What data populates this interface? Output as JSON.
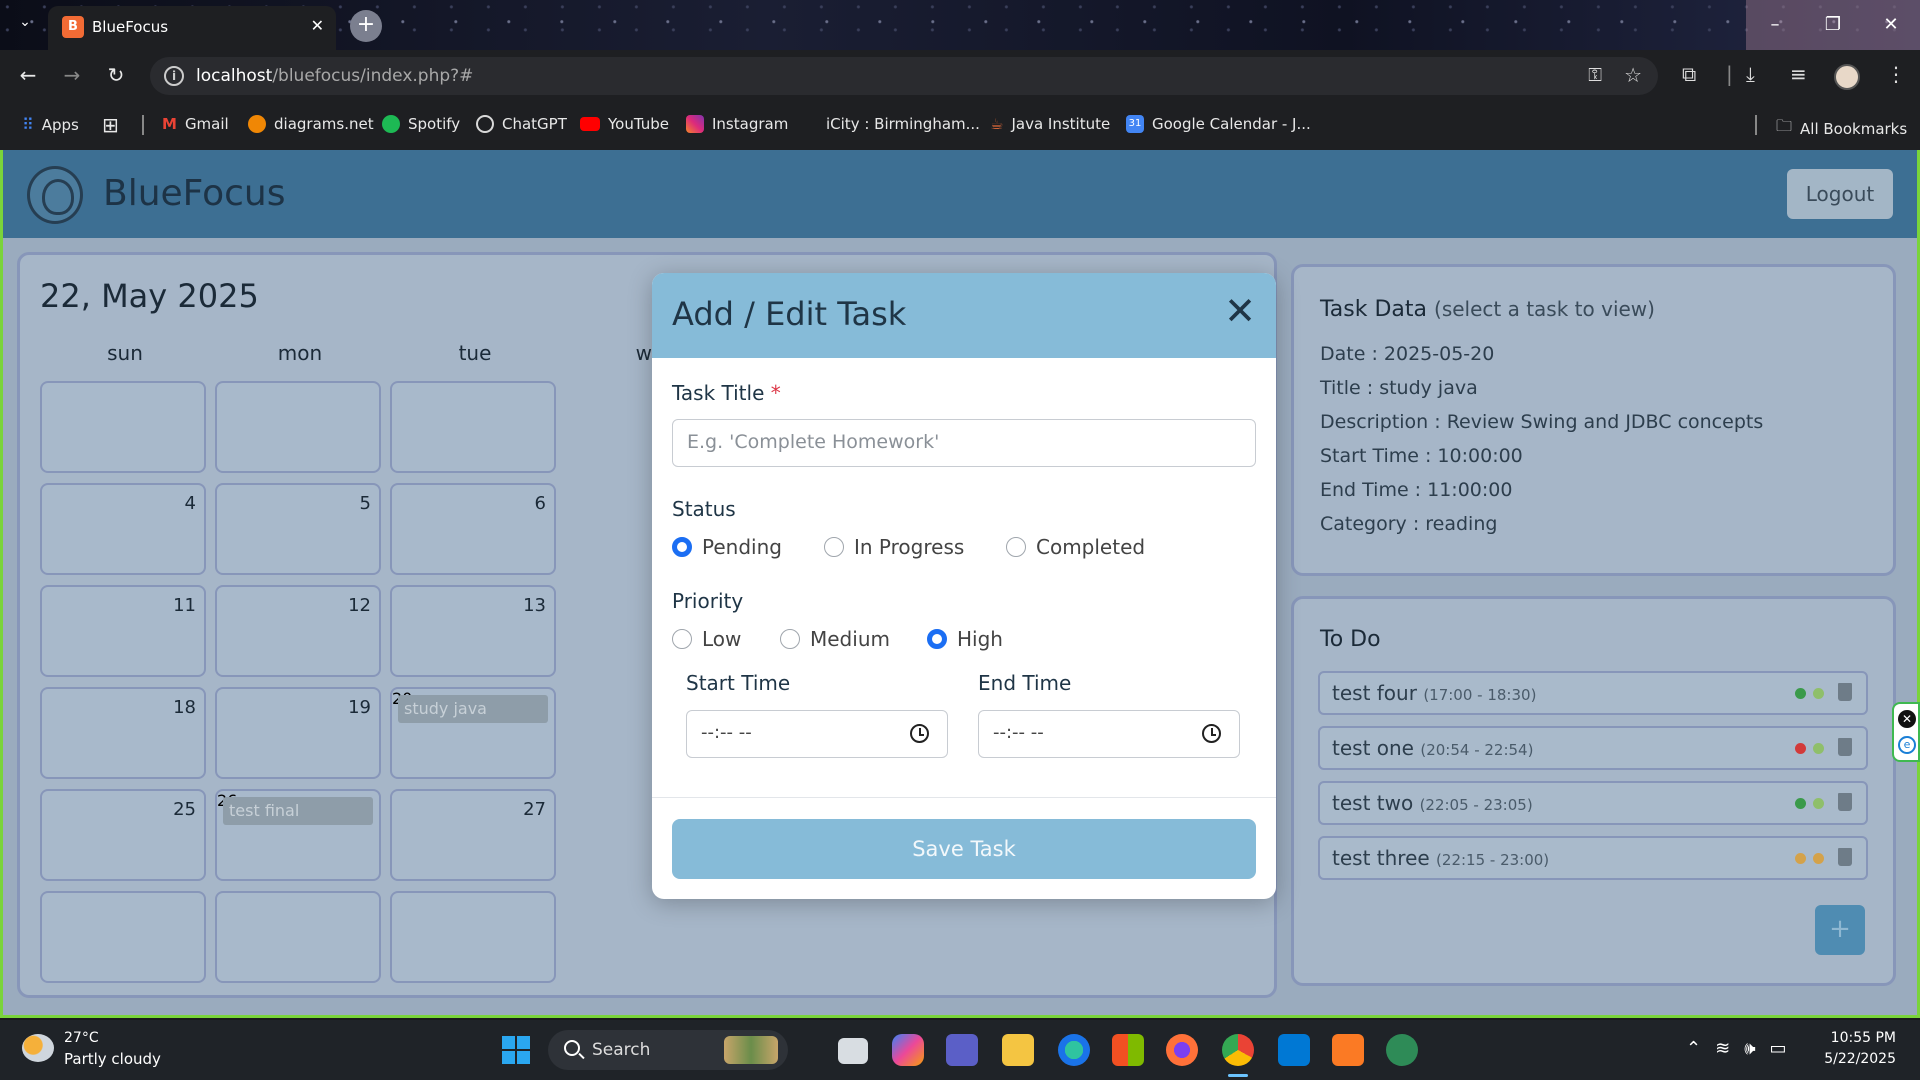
{
  "browser": {
    "tab_title": "BlueFocus",
    "url_host": "localhost",
    "url_path": "/bluefocus/index.php?#",
    "bookmarks": [
      {
        "label": "Apps",
        "color": "#ea4335"
      },
      {
        "label": "Gmail",
        "color": "#ea4335"
      },
      {
        "label": "diagrams.net",
        "color": "#f08705"
      },
      {
        "label": "Spotify",
        "color": "#1db954"
      },
      {
        "label": "ChatGPT",
        "color": "#d9d9d9"
      },
      {
        "label": "YouTube",
        "color": "#ff0000"
      },
      {
        "label": "Instagram",
        "color": "#e1306c"
      },
      {
        "label": "iCity : Birmingham...",
        "color": "#1e1f22"
      },
      {
        "label": "Java Institute",
        "color": "#c0392b"
      },
      {
        "label": "Google Calendar - J...",
        "color": "#4285f4"
      }
    ],
    "all_bookmarks": "All Bookmarks"
  },
  "app": {
    "title": "BlueFocus",
    "logout_label": "Logout"
  },
  "calendar": {
    "current_date": "22, May 2025",
    "day_headers": [
      "sun",
      "mon",
      "tue",
      "we"
    ],
    "cells": [
      {
        "num": ""
      },
      {
        "num": ""
      },
      {
        "num": ""
      },
      {
        "num": "4"
      },
      {
        "num": "5"
      },
      {
        "num": "6"
      },
      {
        "num": "11"
      },
      {
        "num": "12"
      },
      {
        "num": "13"
      },
      {
        "num": "18"
      },
      {
        "num": "19"
      },
      {
        "num": "20",
        "event": "study java"
      },
      {
        "num": "25"
      },
      {
        "num": "26",
        "event": "test final"
      },
      {
        "num": "27"
      },
      {
        "num": ""
      },
      {
        "num": ""
      },
      {
        "num": ""
      }
    ]
  },
  "task_data": {
    "title": "Task Data",
    "subtitle": "(select a task to view)",
    "lines": [
      "Date : 2025-05-20",
      "Title : study java",
      "Description : Review Swing and JDBC concepts",
      "Start Time : 10:00:00",
      "End Time : 11:00:00",
      "Category : reading"
    ]
  },
  "todo": {
    "title": "To Do",
    "items": [
      {
        "name": "test four",
        "time": "(17:00 - 18:30)",
        "dot1": "#3a9a4a",
        "dot2": "#8fbf6a"
      },
      {
        "name": "test one",
        "time": "(20:54 - 22:54)",
        "dot1": "#d23a3a",
        "dot2": "#8fbf6a"
      },
      {
        "name": "test two",
        "time": "(22:05 - 23:05)",
        "dot1": "#3a9a4a",
        "dot2": "#8fbf6a"
      },
      {
        "name": "test three",
        "time": "(22:15 - 23:00)",
        "dot1": "#d4a24a",
        "dot2": "#d4a24a"
      }
    ],
    "add_label": "+"
  },
  "modal": {
    "title": "Add / Edit Task",
    "close_label": "✕",
    "task_title_label": "Task Title",
    "required_mark": "*",
    "task_title_placeholder": "E.g. 'Complete Homework'",
    "status_label": "Status",
    "status_options": [
      {
        "label": "Pending",
        "checked": true
      },
      {
        "label": "In Progress",
        "checked": false
      },
      {
        "label": "Completed",
        "checked": false
      }
    ],
    "priority_label": "Priority",
    "priority_options": [
      {
        "label": "Low",
        "checked": false
      },
      {
        "label": "Medium",
        "checked": false
      },
      {
        "label": "High",
        "checked": true
      }
    ],
    "start_time_label": "Start Time",
    "end_time_label": "End Time",
    "start_time_value": "--:-- --",
    "end_time_value": "--:-- --",
    "save_label": "Save Task"
  },
  "taskbar": {
    "temp": "27°C",
    "weather": "Partly cloudy",
    "search_label": "Search",
    "time": "10:55 PM",
    "date": "5/22/2025"
  }
}
